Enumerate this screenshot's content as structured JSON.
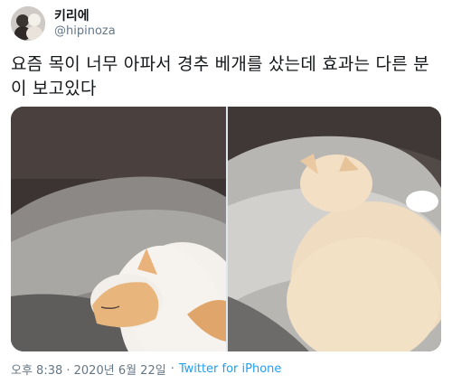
{
  "user": {
    "display_name": "키리에",
    "handle": "@hipinoza"
  },
  "tweet": {
    "text": "요즘 목이 너무 아파서 경추 베개를 샀는데 효과는 다른 분이 보고있다"
  },
  "media": {
    "photos": [
      {
        "subject": "cat sleeping on cervical pillow"
      },
      {
        "subject": "cat lying on cervical pillow"
      }
    ]
  },
  "footer": {
    "timestamp": "오후 8:38 · 2020년 6월 22일",
    "separator": "·",
    "source": "Twitter for iPhone"
  },
  "colors": {
    "text": "#14171a",
    "secondary": "#657786",
    "link": "#1da1f2"
  }
}
